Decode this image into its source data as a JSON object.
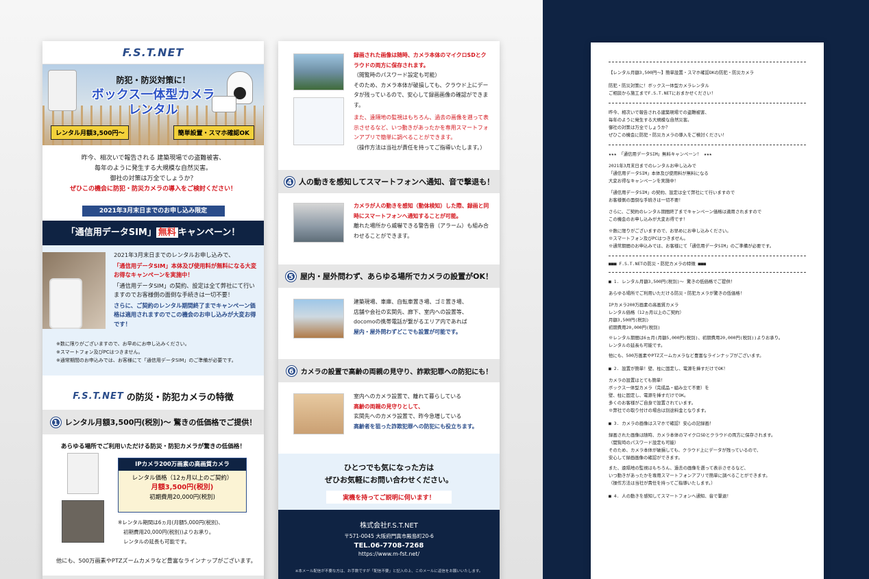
{
  "brand": {
    "logo": "F.S.T.NET"
  },
  "hero": {
    "subtitle": "防犯・防災対策に！",
    "title_line1": "ボックス一体型カメラ",
    "title_line2": "レンタル",
    "badge_rent": "レンタル月額3,500円〜",
    "badge_easy": "簡単設置・スマホ確認OK"
  },
  "intro": {
    "line1": "昨今、相次いで報告される 建築現場での盗難被害、",
    "line2": "毎年のように発生する大規模な自然災害。",
    "line3": "御社の対策は万全でしょうか？",
    "line4": "ぜひこの機会に防犯・防災カメラの導入をご検討ください！"
  },
  "campaign": {
    "ribbon": "2021年3月末日までのお申し込み限定",
    "bar_pre": "「通信用データSIM」",
    "bar_hl": "無料",
    "bar_post": "キャンペーン！",
    "p1": "2021年3月末日までのレンタルお申し込みで、",
    "p2": "「通信用データSIM」本体及び使用料が無料になる大変お得なキャンペーンを実施中！",
    "p3": "「通信用データSIM」の契約、設定は全て弊社にて行いますのでお客様側の面倒な手続きは一切不要！",
    "p4": "さらに、ご契約のレンタル期間終了までキャンペーン価格は適用されますのでこの機会のお申し込みが大変お得です！",
    "notes": [
      "※数に限りがございますので、お早めにお申し込みください。",
      "※スマートフォン及びPCはつきません。",
      "※通常期間のお申込みでは、お客様にて「通信用データSIM」のご準備が必要です。"
    ]
  },
  "features": {
    "title": "の防災・防犯カメラの特徴"
  },
  "sec1": {
    "num": "1",
    "title": "レンタル月額3,500円(税別)〜 驚きの低価格でご提供！",
    "lead": "あらゆる場所でご利用いただける防災・防犯カメラが驚きの低価格！",
    "box_title": "IPカメラ200万画素の高画質カメラ",
    "box_l1": "レンタル価格（12ヵ月以上のご契約）",
    "box_l2": "月額3,500円(税別)",
    "box_l3": "初期費用20,000円(税別)",
    "note1": "※レンタル期間は6ヵ月(月額5,000円(税別)、",
    "note2": "初期費用20,000円(税別))よりお承り。",
    "note3": "レンタルの延長も可能です。",
    "footer": "他にも、500万画素やPTZズームカメラなど豊富なラインナップがございます。"
  },
  "sec3": {
    "t1": "録画された画像は随時、カメラ本体のマイクロSDとクラウドの両方に保存されます。",
    "t2": "（閲覧時のパスワード設定も可能）",
    "t3": "そのため、カメラ本体が破損しても、クラウド上にデータが残っているので、安心して録画画像の確認ができます。",
    "t4": "また、遠隔地の監視はもちろん、過去の画像を遡って表示させるなど、いつ動きがあったかを専用スマートフォンアプリで簡単に調べることができます。",
    "t5": "（操作方法は当社が責任を持ってご指導いたします。）"
  },
  "sec4": {
    "num": "4",
    "title": "人の動きを感知してスマートフォンへ通知、音で撃退も！",
    "t1": "カメラが人の動きを感知（動体検知）した際、録画と同時にスマートフォンへ通知することが可能。",
    "t2": "離れた場所から威嚇できる警告音（アラーム）も組み合わせることができます。"
  },
  "sec5": {
    "num": "5",
    "title": "屋内・屋外問わず、あらゆる場所でカメラの設置がOK！",
    "t1": "建築現場、車庫、自転車置き場、ゴミ置き場、",
    "t2": "店舗や会社の玄関先、廊下、室内への設置等、",
    "t3": "docomoの携帯電話が繋がるエリア内であれば",
    "t4": "屋内・屋外問わずどこでも設置が可能です。"
  },
  "sec6": {
    "num": "6",
    "title": "カメラの設置で高齢の両親の見守り、詐欺犯罪への防犯にも！",
    "t1": "室内へのカメラ設置で、離れて暮らしている",
    "t2": "高齢の両親の見守りとして、",
    "t3": "玄関先へのカメラ設置で、昨今急増している",
    "t4": "高齢者を狙った詐欺犯罪への防犯にも役立ちます。"
  },
  "cta": {
    "line1": "ひとつでも気になった方は",
    "line2": "ぜひお気軽にお問い合わせください。",
    "button": "実機を持ってご説明に伺います！"
  },
  "footer": {
    "company": "株式会社F.S.T.NET",
    "address": "〒571-0045 大阪府門真市殿島町20-6",
    "tel": "TEL.06-7708-7268",
    "url": "https://www.m-fst.net/",
    "note": "※本メール配信が不要な方は、お手数ですが「配信不要」と記入の上、このメールに返信をお願いいたします。"
  },
  "text_mail": {
    "lines": [
      "【レンタル月額3,500円〜】簡単設置・スマホ確認OKの防犯・防災カメラ",
      "防犯・防災対策に！ボックス一体型カメラレンタル",
      "ご相談から施工までF.S.T.NETにおまかせください！",
      "昨今、相次いで報告される建築現場での盗難被害、",
      "毎年のように発生する大規模な自然災害。",
      "御社の対策は万全でしょうか？",
      "ぜひこの機会に防犯・防災カメラの導入をご検討ください！",
      "★★★ 「通信用データSIM」無料キャンペーン！ ★★★",
      "2021年3月末日までのレンタルお申し込みで",
      "「通信用データSIM」本体及び使用料が無料になる",
      "大変お得なキャンペーンを実施中！",
      "「通信用データSIM」の契約、設定は全て弊社にて行いますので",
      "お客様側の面倒な手続きは一切不要！",
      "さらに、ご契約のレンタル期間終了までキャンペーン価格は適用されますので",
      "この機会のお申し込みが大変お得です！",
      "※数に限りがございますので、お早めにお申し込みください。",
      "※スマートフォン及びPCはつきません。",
      "※通常期間のお申込みでは、お客様にて「通信用データSIM」のご準備が必要です。",
      "■■■ F.S.T.NETの防災・防犯カメラの特徴 ■■■",
      "■ 1. レンタル月額3,500円(税別)〜 驚きの低価格でご提供！",
      "あらゆる場所でご利用いただける防災・防犯カメラが驚きの低価格！",
      "IPカメラ200万画素の高画質カメラ",
      "レンタル価格（12ヵ月以上のご契約）",
      "月額3,500円(税別)",
      "初期費用20,000円(税別)",
      "※レンタル期間は6ヵ月(月額5,000円(税別)、初期費用20,000円(税別))よりお承り。",
      "レンタルの延長も可能です。",
      "他にも、500万画素やPTZズームカメラなど豊富なラインナップがございます。",
      "■ 2. 設置が簡単！壁、柱に固定し、電源を挿すだけでOK！",
      "カメラの設置はとても簡単！",
      "ボックス一体型カメラ（完成品・組み立て不要）を",
      "壁、柱に固定し、電源を挿すだけでOK。",
      "多くのお客様がご自身で設置されています。",
      "※弊社での取り付けの場合は別途料金となります。",
      "■ 3. カメラの画像はスマホで確認！安心の記録画！",
      "録画された画像は随時、カメラ本体のマイクロSDとクラウドの両方に保存されます。",
      "（閲覧時のパスワード設定も可能）",
      "そのため、カメラ本体が破損しても、クラウド上にデータが残っているので、",
      "安心して録画画像の確認ができます。",
      "また、遠隔地の監視はもちろん、過去の画像を遡って表示させるなど、",
      "いつ動きがあったかを専用スマートフォンアプリで簡単に調べることができます。",
      "（操作方法は当社が責任を持ってご指導いたします。）",
      "■ 4. 人の動きを感知してスマートフォンへ通知、音で撃退！"
    ]
  }
}
